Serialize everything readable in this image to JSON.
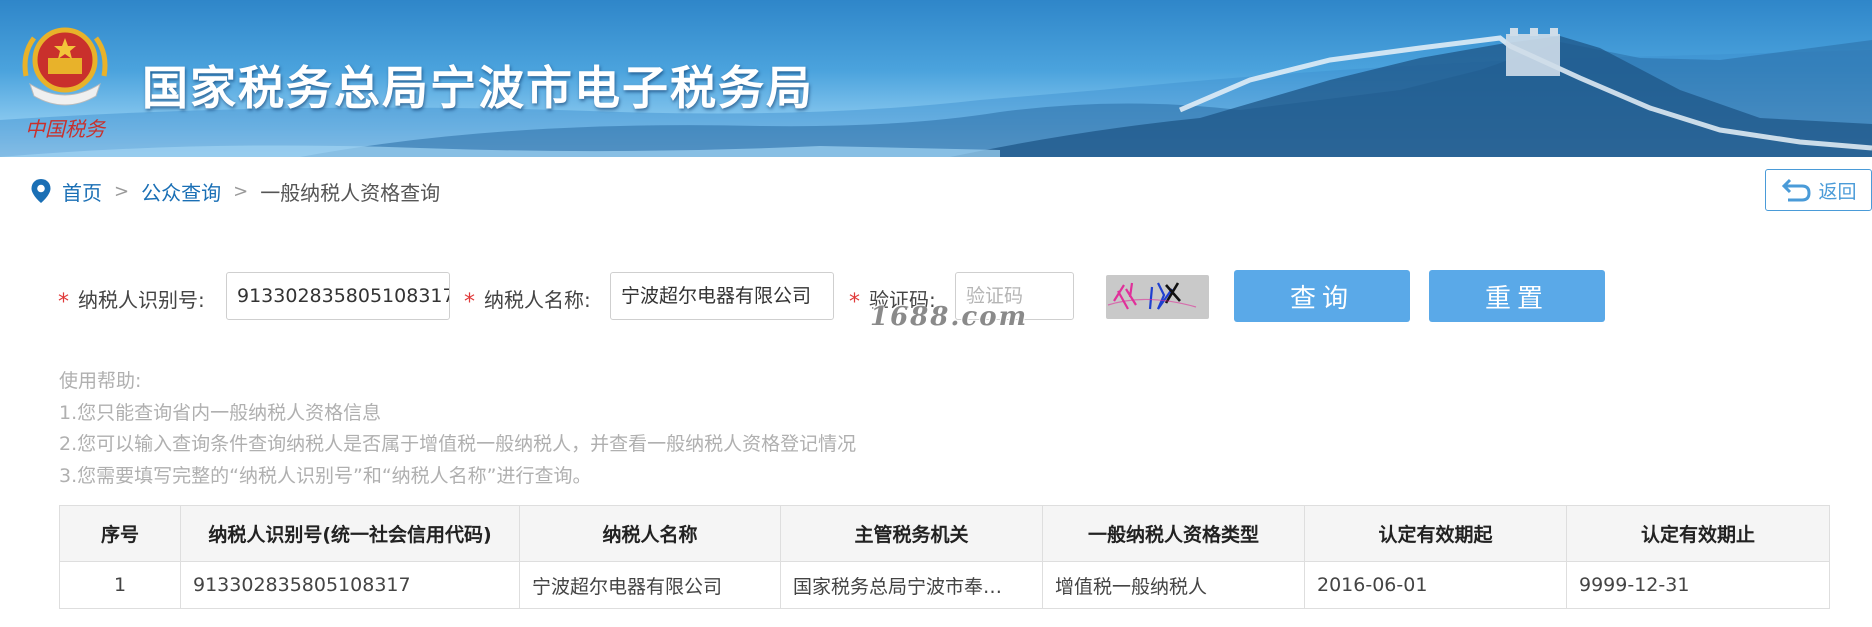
{
  "header": {
    "emblem_caption": "中国税务",
    "site_title": "国家税务总局宁波市电子税务局"
  },
  "breadcrumb": {
    "home": "首页",
    "public_query": "公众查询",
    "current": "一般纳税人资格查询",
    "separator": ">"
  },
  "back_button": {
    "label": "返回"
  },
  "form": {
    "required_mark": "*",
    "taxpayer_id_label": "纳税人识别号:",
    "taxpayer_id_value": "913302835805108317",
    "taxpayer_name_label": "纳税人名称:",
    "taxpayer_name_value": "宁波超尔电器有限公司",
    "captcha_label": "验证码:",
    "captcha_placeholder": "验证码",
    "captcha_text": "外以",
    "query_button": "查询",
    "reset_button": "重置"
  },
  "watermark": "1688.com",
  "help": {
    "title": "使用帮助:",
    "line1": "1.您只能查询省内一般纳税人资格信息",
    "line2": "2.您可以输入查询条件查询纳税人是否属于增值税一般纳税人，并查看一般纳税人资格登记情况",
    "line3": "3.您需要填写完整的“纳税人识别号”和“纳税人名称”进行查询。"
  },
  "table": {
    "headers": [
      "序号",
      "纳税人识别号(统一社会信用代码)",
      "纳税人名称",
      "主管税务机关",
      "一般纳税人资格类型",
      "认定有效期起",
      "认定有效期止"
    ],
    "rows": [
      [
        "1",
        "913302835805108317",
        "宁波超尔电器有限公司",
        "国家税务总局宁波市奉…",
        "增值税一般纳税人",
        "2016-06-01",
        "9999-12-31"
      ]
    ]
  },
  "colors": {
    "link": "#1a6fb5",
    "button": "#5aa9e8",
    "required": "#e03a3a",
    "help_text": "#b0b0b0"
  }
}
